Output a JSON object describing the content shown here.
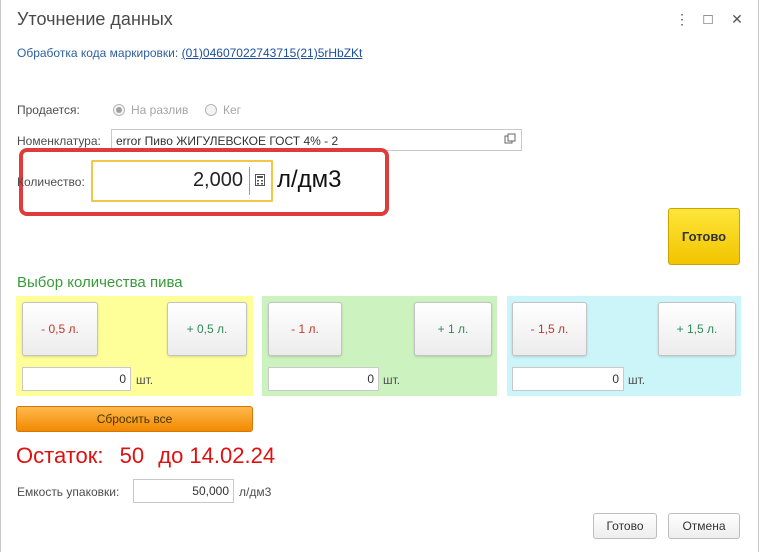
{
  "window": {
    "title": "Уточнение данных",
    "more_glyph": "⋮",
    "maximize_glyph": "□",
    "close_glyph": "✕"
  },
  "marking": {
    "label": "Обработка кода маркировки:",
    "code": "(01)04607022743715(21)5rHbZKt"
  },
  "sold": {
    "label": "Продается:",
    "options": [
      {
        "label": "На разлив",
        "selected": true
      },
      {
        "label": "Кег",
        "selected": false
      }
    ]
  },
  "nomenclature": {
    "label": "Номенклатура:",
    "value": "error  Пиво ЖИГУЛЕВСКОЕ ГОСТ 4% - 2"
  },
  "quantity": {
    "label": "Количество:",
    "value": "2,000",
    "unit": "л/дм3"
  },
  "done_big_label": "Готово",
  "beer_selection": {
    "title": "Выбор количества пива",
    "panels": [
      {
        "minus_label": "- 0,5 л.",
        "plus_label": "+ 0,5 л.",
        "count": "0",
        "unit": "шт.",
        "color": "#ffff99"
      },
      {
        "minus_label": "- 1 л.",
        "plus_label": "+ 1 л.",
        "count": "0",
        "unit": "шт.",
        "color": "#ccf2bf"
      },
      {
        "minus_label": "- 1,5 л.",
        "plus_label": "+ 1,5 л.",
        "count": "0",
        "unit": "шт.",
        "color": "#ccf5f9"
      }
    ],
    "reset_label": "Сбросить все"
  },
  "remainder": {
    "label": "Остаток:",
    "value": "50",
    "until": "до 14.02.24"
  },
  "package": {
    "label": "Емкость упаковки:",
    "value": "50,000",
    "unit": "л/дм3"
  },
  "footer": {
    "done_label": "Готово",
    "cancel_label": "Отмена"
  },
  "colors": {
    "highlight_frame": "#e03b3b",
    "done_button": "#f5cf0f",
    "reset_button": "#f59a1a",
    "remainder_text": "#e01010",
    "section_title": "#3a9a3a"
  }
}
